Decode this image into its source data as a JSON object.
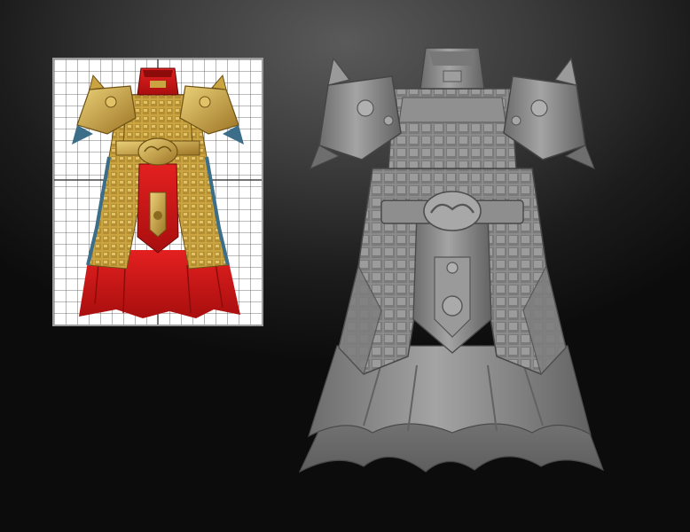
{
  "scene": {
    "background_color": "#2a2a2a",
    "reference_panel": {
      "kind": "textured concept of armored robe on uv grid",
      "grid_color": "#3a3a3a",
      "texture_colors": {
        "gold": "#c9a441",
        "gold_dark": "#8a6a1f",
        "red": "#d81818",
        "red_dark": "#8c0c0c",
        "blue_trim": "#3c6e8a"
      }
    },
    "render_panel": {
      "kind": "untextured sculpt render of armored robe",
      "material_color": "#8d8d8d",
      "shadow_color": "#5a5a5a",
      "highlight_color": "#b4b4b4"
    }
  }
}
